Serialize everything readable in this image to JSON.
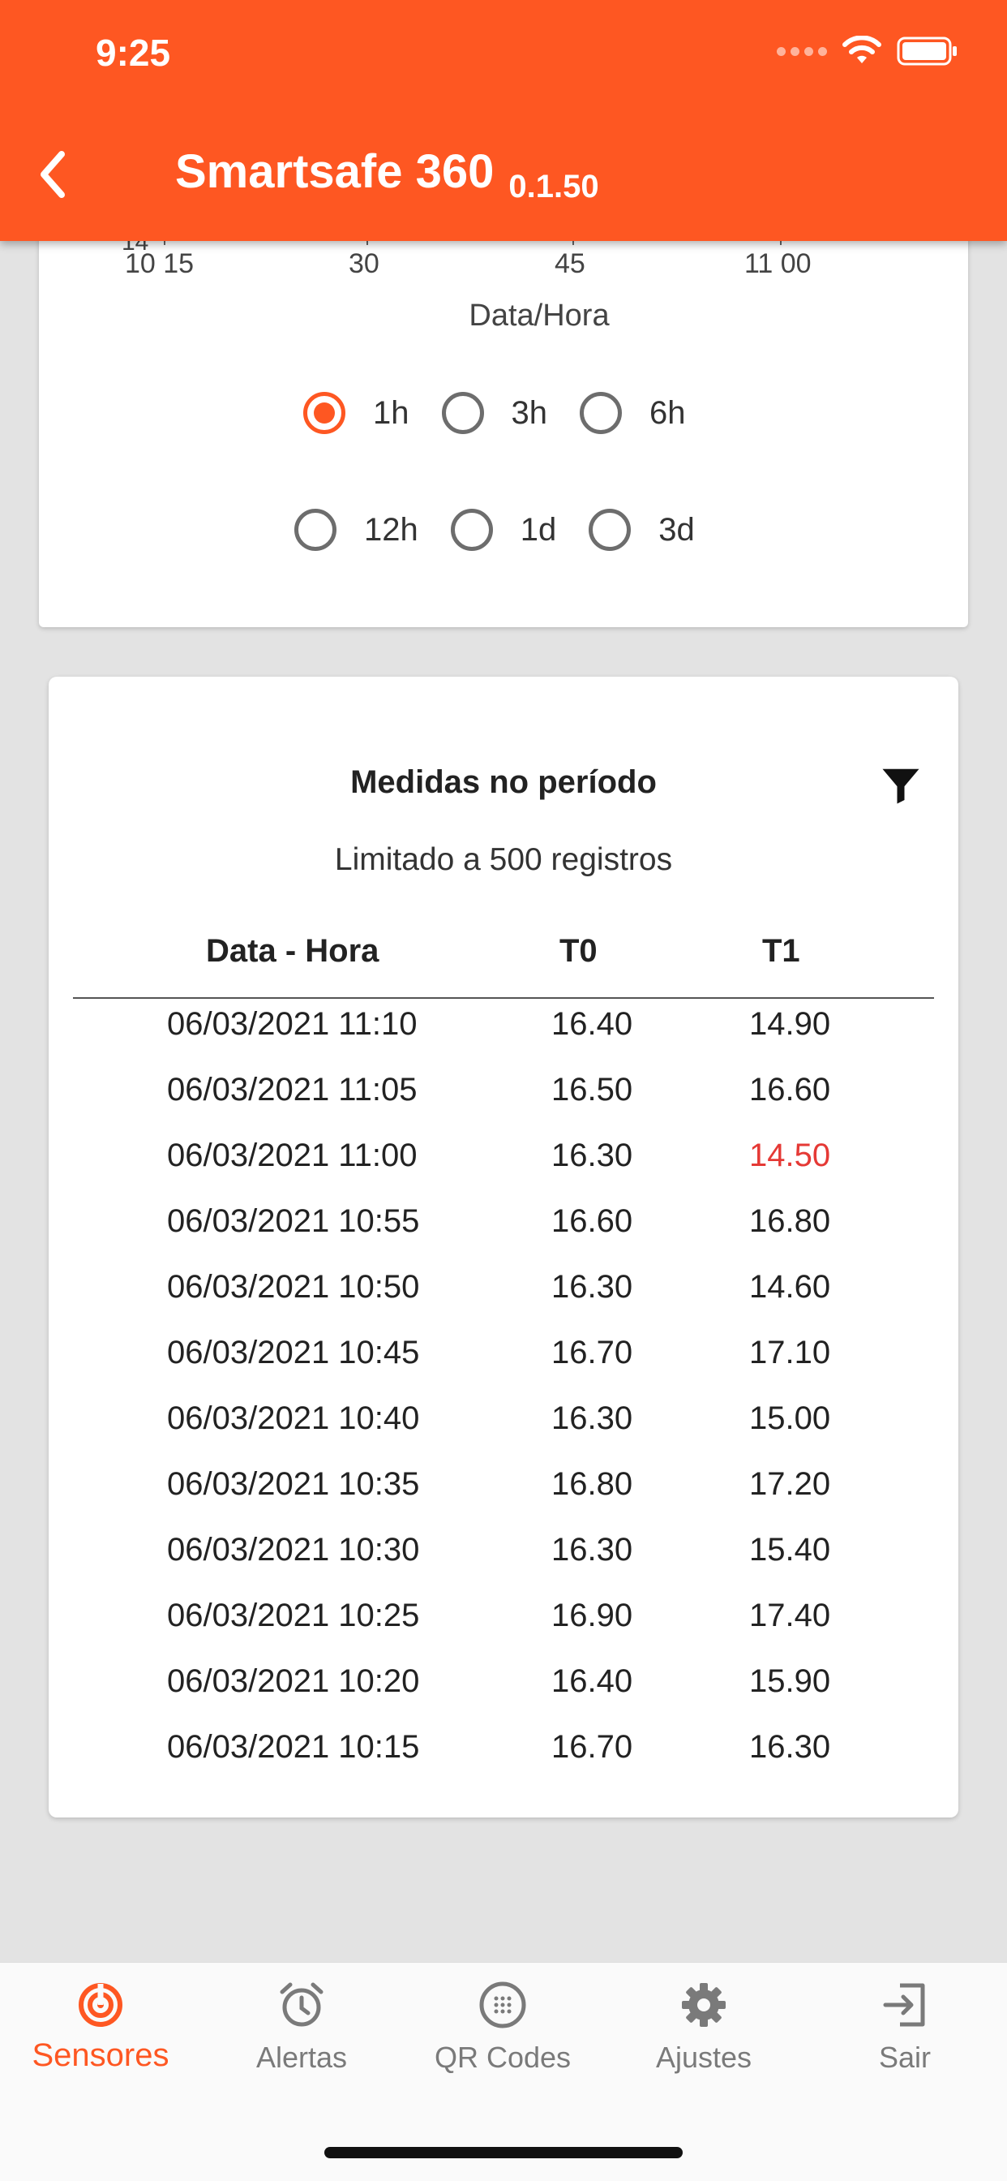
{
  "status_bar": {
    "time": "9:25"
  },
  "header": {
    "title": "Smartsafe 360",
    "version": "0.1.50"
  },
  "chart": {
    "x_ticks": [
      "10 15",
      "30",
      "45",
      "11 00"
    ],
    "partial_tick_above": "14",
    "xlabel": "Data/Hora"
  },
  "period_options": {
    "row1": [
      {
        "label": "1h",
        "checked": true
      },
      {
        "label": "3h",
        "checked": false
      },
      {
        "label": "6h",
        "checked": false
      }
    ],
    "row2": [
      {
        "label": "12h",
        "checked": false
      },
      {
        "label": "1d",
        "checked": false
      },
      {
        "label": "3d",
        "checked": false
      }
    ]
  },
  "measures": {
    "title": "Medidas no período",
    "subtitle": "Limitado a 500 registros",
    "columns": [
      "Data - Hora",
      "T0",
      "T1"
    ],
    "rows": [
      {
        "datetime": "06/03/2021 11:10",
        "t0": "16.40",
        "t1": "14.90",
        "t1_alert": false
      },
      {
        "datetime": "06/03/2021 11:05",
        "t0": "16.50",
        "t1": "16.60",
        "t1_alert": false
      },
      {
        "datetime": "06/03/2021 11:00",
        "t0": "16.30",
        "t1": "14.50",
        "t1_alert": true
      },
      {
        "datetime": "06/03/2021 10:55",
        "t0": "16.60",
        "t1": "16.80",
        "t1_alert": false
      },
      {
        "datetime": "06/03/2021 10:50",
        "t0": "16.30",
        "t1": "14.60",
        "t1_alert": false
      },
      {
        "datetime": "06/03/2021 10:45",
        "t0": "16.70",
        "t1": "17.10",
        "t1_alert": false
      },
      {
        "datetime": "06/03/2021 10:40",
        "t0": "16.30",
        "t1": "15.00",
        "t1_alert": false
      },
      {
        "datetime": "06/03/2021 10:35",
        "t0": "16.80",
        "t1": "17.20",
        "t1_alert": false
      },
      {
        "datetime": "06/03/2021 10:30",
        "t0": "16.30",
        "t1": "15.40",
        "t1_alert": false
      },
      {
        "datetime": "06/03/2021 10:25",
        "t0": "16.90",
        "t1": "17.40",
        "t1_alert": false
      },
      {
        "datetime": "06/03/2021 10:20",
        "t0": "16.40",
        "t1": "15.90",
        "t1_alert": false
      },
      {
        "datetime": "06/03/2021 10:15",
        "t0": "16.70",
        "t1": "16.30",
        "t1_alert": false
      }
    ]
  },
  "bottom_nav": [
    {
      "label": "Sensores",
      "icon": "sensor-icon",
      "active": true
    },
    {
      "label": "Alertas",
      "icon": "alarm-clock-icon",
      "active": false
    },
    {
      "label": "QR Codes",
      "icon": "qr-code-icon",
      "active": false
    },
    {
      "label": "Ajustes",
      "icon": "gear-icon",
      "active": false
    },
    {
      "label": "Sair",
      "icon": "exit-icon",
      "active": false
    }
  ],
  "colors": {
    "accent": "#fe5722",
    "alert": "#e53935",
    "inactive": "#7a7a7a"
  }
}
